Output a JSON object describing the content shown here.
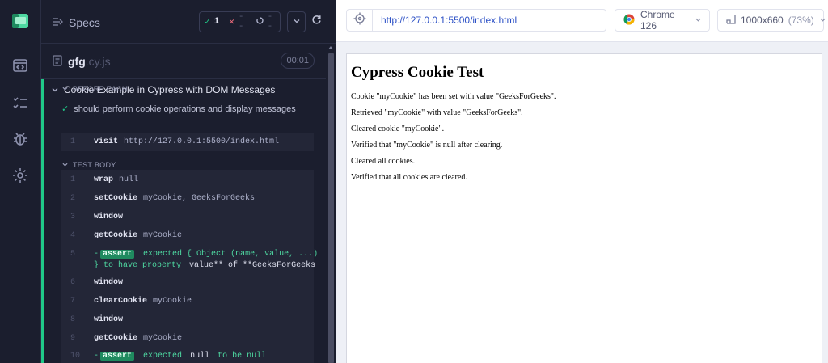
{
  "reporter": {
    "specs_label": "Specs",
    "stats": {
      "passed": "1",
      "failed": "--",
      "pending": "--"
    },
    "file": {
      "name": "gfg",
      "ext": ".cy.js",
      "duration": "00:01"
    },
    "suite": {
      "title": "Cookie Example in Cypress with DOM Messages",
      "test_title": "should perform cookie operations and display messages",
      "before_each_label": "BEFORE EACH",
      "test_body_label": "TEST BODY",
      "before_each": [
        {
          "num": "1",
          "name": "visit",
          "args": "http://127.0.0.1:5500/index.html"
        }
      ],
      "body": [
        {
          "num": "1",
          "name": "wrap",
          "args": "null"
        },
        {
          "num": "2",
          "name": "setCookie",
          "args": "myCookie, GeeksForGeeks"
        },
        {
          "num": "3",
          "name": "window",
          "args": ""
        },
        {
          "num": "4",
          "name": "getCookie",
          "args": "myCookie"
        },
        {
          "num": "5",
          "assert": "assert",
          "line1": "expected { Object (name, value, ...)",
          "line2_a": "} to have property",
          "line2_b": "value** of **GeeksForGeeks"
        },
        {
          "num": "6",
          "name": "window",
          "args": ""
        },
        {
          "num": "7",
          "name": "clearCookie",
          "args": "myCookie"
        },
        {
          "num": "8",
          "name": "window",
          "args": ""
        },
        {
          "num": "9",
          "name": "getCookie",
          "args": "myCookie"
        },
        {
          "num": "10",
          "assert": "assert",
          "a": "expected",
          "b": "null",
          "c": "to be null"
        }
      ]
    }
  },
  "browser": {
    "url": "http://127.0.0.1:5500/index.html",
    "browser_name": "Chrome 126",
    "viewport": "1000x660",
    "zoom": "(73%)"
  },
  "aut": {
    "heading": "Cypress Cookie Test",
    "messages": [
      "Cookie \"myCookie\" has been set with value \"GeeksForGeeks\".",
      "Retrieved \"myCookie\" with value \"GeeksForGeeks\".",
      "Cleared cookie \"myCookie\".",
      "Verified that \"myCookie\" is null after clearing.",
      "Cleared all cookies.",
      "Verified that all cookies are cleared."
    ]
  },
  "colors": {
    "pass": "#20c988",
    "fail": "#f26d7d",
    "url": "#2e52c6"
  },
  "icons": {
    "logo": "cypress-logo-icon",
    "nav": [
      "browser-window-icon",
      "list-checks-icon",
      "bug-icon",
      "gear-icon"
    ],
    "specs": "list-arrow-icon",
    "file": "document-icon",
    "url_left": "crosshair-icon",
    "browser": "chrome-icon",
    "viewport": "resize-icon"
  }
}
